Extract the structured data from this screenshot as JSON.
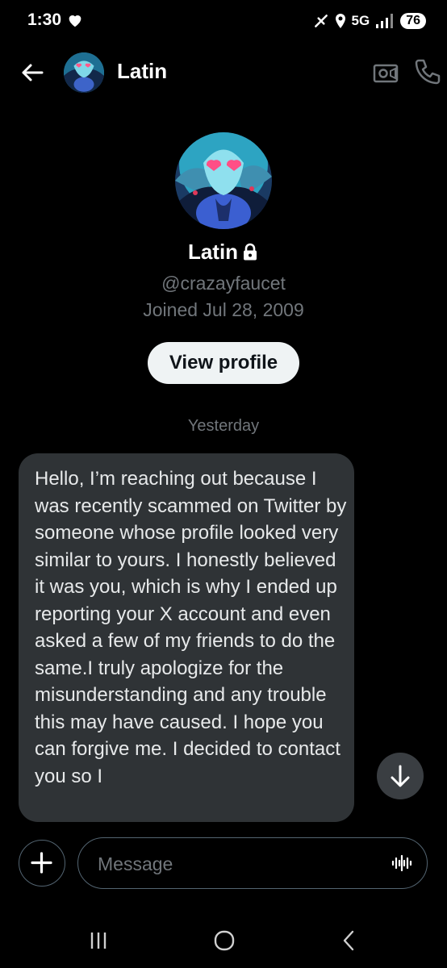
{
  "status_bar": {
    "time": "1:30",
    "network": "5G",
    "battery": "76"
  },
  "header": {
    "name": "Latin"
  },
  "profile": {
    "name": "Latin",
    "handle": "@crazayfaucet",
    "joined": "Joined Jul 28, 2009",
    "view_profile_label": "View profile"
  },
  "conversation": {
    "date_separator": "Yesterday",
    "messages": [
      {
        "direction": "incoming",
        "text": "Hello, I’m reaching out because I was recently scammed on Twitter by someone whose profile looked very similar to yours. I honestly believed it was you, which is why I ended up reporting your X account and even asked a few of my friends to do the same.I truly apologize for the misunderstanding and any trouble this may have caused. I hope you can forgive me. I decided to contact you so I"
      }
    ]
  },
  "composer": {
    "placeholder": "Message"
  },
  "icons": {
    "status": [
      "heart-icon",
      "data-saver-icon",
      "location-icon",
      "signal-icon"
    ],
    "header": [
      "back-arrow-icon",
      "video-call-icon",
      "phone-icon"
    ],
    "composer": [
      "plus-icon",
      "voice-icon"
    ],
    "chat": [
      "arrow-down-icon"
    ],
    "nav": [
      "recent-apps-icon",
      "home-icon",
      "back-icon"
    ]
  },
  "colors": {
    "background": "#000000",
    "bubble": "#2f3336",
    "muted_text": "#71767b",
    "button_bg": "#eff3f4"
  }
}
